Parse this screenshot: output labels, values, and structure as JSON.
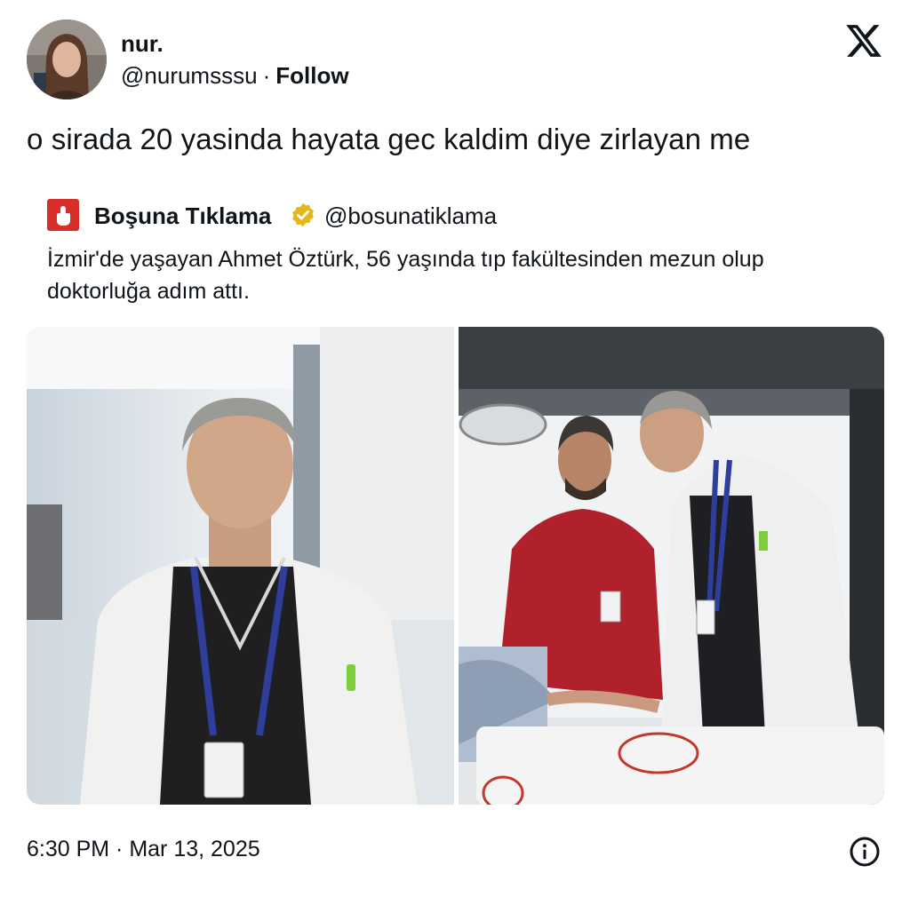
{
  "author": {
    "display_name": "nur.",
    "handle": "@nurumsssu",
    "separator": "·",
    "follow_label": "Follow",
    "avatar_icon": "profile-photo"
  },
  "platform_icon": "x-logo-icon",
  "tweet": {
    "text": "o sirada 20 yasinda hayata gec kaldim diye zirlayan me",
    "timestamp": "6:30 PM · Mar 13, 2025"
  },
  "quoted": {
    "name": "Boşuna Tıklama",
    "handle": "@bosunatiklama",
    "verified": true,
    "verified_color": "#e2b719",
    "icon_color": "#d72e2a",
    "text": "İzmir'de yaşayan Ahmet Öztürk, 56 yaşında tıp fakültesinden mezun olup doktorluğa adım attı."
  },
  "media": [
    {
      "description_icon": "photo-doctor-in-hallway"
    },
    {
      "description_icon": "photo-doctors-at-patient-bed"
    }
  ]
}
